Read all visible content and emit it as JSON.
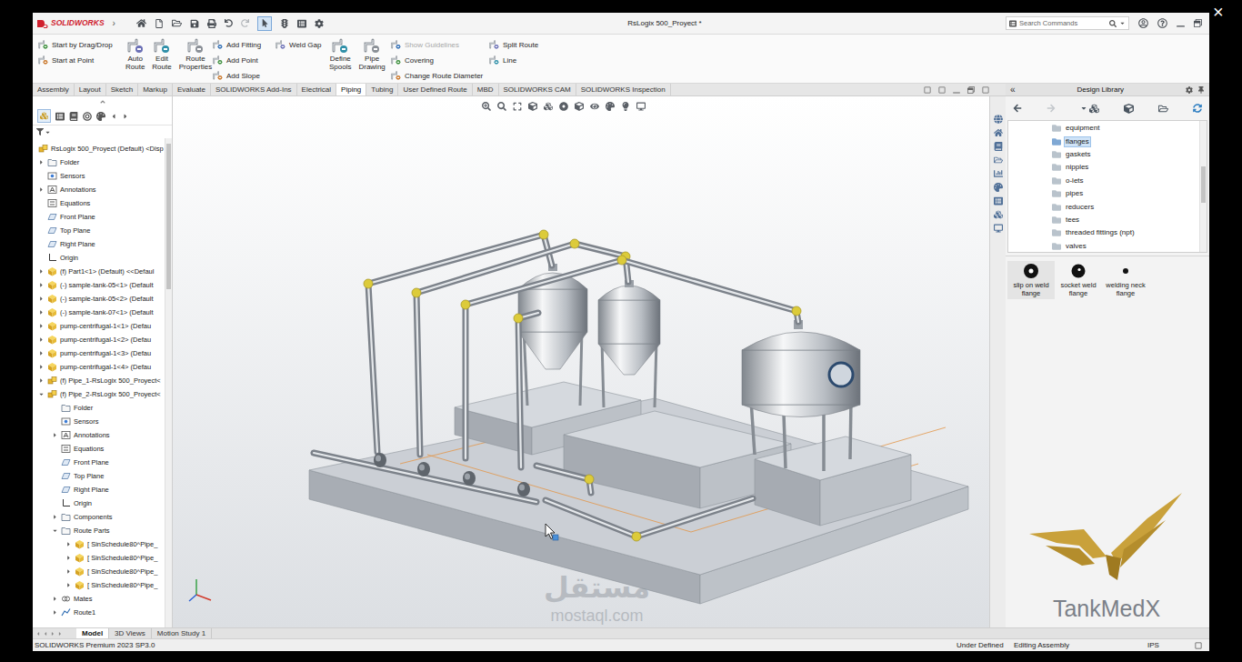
{
  "window": {
    "app": "SOLIDWORKS",
    "app_menu": "›",
    "title": "RsLogix 500_Proyect *"
  },
  "player": {
    "close": "×"
  },
  "title_toolbar": {
    "select_active": true
  },
  "search": {
    "placeholder": "Search Commands"
  },
  "ribbon": [
    {
      "kind": "stack",
      "items": [
        {
          "label": "Start by Drag/Drop",
          "disabled": false
        },
        {
          "label": "Start at Point",
          "disabled": false
        }
      ]
    },
    {
      "kind": "large",
      "items": [
        {
          "label": "Auto Route",
          "disabled": false
        },
        {
          "label": "Edit Route",
          "disabled": false
        },
        {
          "label": "Route Properties",
          "disabled": false
        }
      ]
    },
    {
      "kind": "stack",
      "items": [
        {
          "label": "Add Fitting",
          "disabled": false
        },
        {
          "label": "Add Point",
          "disabled": false
        },
        {
          "label": "Add Slope",
          "disabled": false
        }
      ]
    },
    {
      "kind": "stack",
      "items": [
        {
          "label": "Weld Gap",
          "disabled": false
        }
      ]
    },
    {
      "kind": "large",
      "items": [
        {
          "label": "Define Spools",
          "disabled": false
        },
        {
          "label": "Pipe Drawing",
          "disabled": false
        }
      ]
    },
    {
      "kind": "stack",
      "items": [
        {
          "label": "Show Guidelines",
          "disabled": true
        },
        {
          "label": "Covering",
          "disabled": false
        },
        {
          "label": "Change Route Diameter",
          "disabled": false
        }
      ]
    },
    {
      "kind": "stack",
      "items": [
        {
          "label": "Split Route",
          "disabled": false
        },
        {
          "label": "Line",
          "disabled": false
        }
      ]
    }
  ],
  "tabs": [
    {
      "label": "Assembly",
      "selected": false
    },
    {
      "label": "Layout",
      "selected": false
    },
    {
      "label": "Sketch",
      "selected": false
    },
    {
      "label": "Markup",
      "selected": false
    },
    {
      "label": "Evaluate",
      "selected": false
    },
    {
      "label": "SOLIDWORKS Add-Ins",
      "selected": false
    },
    {
      "label": "Electrical",
      "selected": false
    },
    {
      "label": "Piping",
      "selected": true
    },
    {
      "label": "Tubing",
      "selected": false
    },
    {
      "label": "User Defined Route",
      "selected": false
    },
    {
      "label": "MBD",
      "selected": false
    },
    {
      "label": "SOLIDWORKS CAM",
      "selected": false
    },
    {
      "label": "SOLIDWORKS Inspection",
      "selected": false
    }
  ],
  "feature_tree": {
    "items": [
      {
        "label": "RsLogix 500_Proyect (Default) <Disp",
        "level": 0,
        "kind": "assembly",
        "expander": "none"
      },
      {
        "label": "Folder",
        "level": 1,
        "kind": "folder",
        "expander": "collapsed"
      },
      {
        "label": "Sensors",
        "level": 1,
        "kind": "sensor",
        "expander": "none"
      },
      {
        "label": "Annotations",
        "level": 1,
        "kind": "annotation",
        "expander": "collapsed"
      },
      {
        "label": "Equations",
        "level": 1,
        "kind": "equation",
        "expander": "none"
      },
      {
        "label": "Front Plane",
        "level": 1,
        "kind": "plane",
        "expander": "none"
      },
      {
        "label": "Top Plane",
        "level": 1,
        "kind": "plane",
        "expander": "none"
      },
      {
        "label": "Right Plane",
        "level": 1,
        "kind": "plane",
        "expander": "none"
      },
      {
        "label": "Origin",
        "level": 1,
        "kind": "origin",
        "expander": "none"
      },
      {
        "label": "(f) Part1<1> (Default) <<Defaul",
        "level": 1,
        "kind": "part",
        "expander": "collapsed"
      },
      {
        "label": "(-) sample-tank-05<1> (Default",
        "level": 1,
        "kind": "part",
        "expander": "collapsed"
      },
      {
        "label": "(-) sample-tank-05<2> (Default",
        "level": 1,
        "kind": "part",
        "expander": "collapsed"
      },
      {
        "label": "(-) sample-tank-07<1> (Default",
        "level": 1,
        "kind": "part",
        "expander": "collapsed"
      },
      {
        "label": "pump-centrifugal-1<1> (Defau",
        "level": 1,
        "kind": "part",
        "expander": "collapsed"
      },
      {
        "label": "pump-centrifugal-1<2> (Defau",
        "level": 1,
        "kind": "part",
        "expander": "collapsed"
      },
      {
        "label": "pump-centrifugal-1<3> (Defau",
        "level": 1,
        "kind": "part",
        "expander": "collapsed"
      },
      {
        "label": "pump-centrifugal-1<4> (Defau",
        "level": 1,
        "kind": "part",
        "expander": "collapsed"
      },
      {
        "label": "(f) Pipe_1-RsLogix 500_Proyect<",
        "level": 1,
        "kind": "assembly",
        "expander": "collapsed"
      },
      {
        "label": "(f) Pipe_2-RsLogix 500_Proyect<",
        "level": 1,
        "kind": "assembly",
        "expander": "expanded"
      },
      {
        "label": "Folder",
        "level": 2,
        "kind": "folder",
        "expander": "none"
      },
      {
        "label": "Sensors",
        "level": 2,
        "kind": "sensor",
        "expander": "none"
      },
      {
        "label": "Annotations",
        "level": 2,
        "kind": "annotation",
        "expander": "collapsed"
      },
      {
        "label": "Equations",
        "level": 2,
        "kind": "equation",
        "expander": "none"
      },
      {
        "label": "Front Plane",
        "level": 2,
        "kind": "plane",
        "expander": "none"
      },
      {
        "label": "Top Plane",
        "level": 2,
        "kind": "plane",
        "expander": "none"
      },
      {
        "label": "Right Plane",
        "level": 2,
        "kind": "plane",
        "expander": "none"
      },
      {
        "label": "Origin",
        "level": 2,
        "kind": "origin",
        "expander": "none"
      },
      {
        "label": "Components",
        "level": 2,
        "kind": "folder",
        "expander": "collapsed"
      },
      {
        "label": "Route Parts",
        "level": 2,
        "kind": "folder",
        "expander": "expanded"
      },
      {
        "label": "[ SinSchedule80^Pipe_",
        "level": 3,
        "kind": "part",
        "expander": "collapsed"
      },
      {
        "label": "[ SinSchedule80^Pipe_",
        "level": 3,
        "kind": "part",
        "expander": "collapsed"
      },
      {
        "label": "[ SinSchedule80^Pipe_",
        "level": 3,
        "kind": "part",
        "expander": "collapsed"
      },
      {
        "label": "[ SinSchedule80^Pipe_",
        "level": 3,
        "kind": "part",
        "expander": "collapsed"
      },
      {
        "label": "Mates",
        "level": 2,
        "kind": "mates",
        "expander": "collapsed"
      },
      {
        "label": "Route1",
        "level": 2,
        "kind": "route",
        "expander": "collapsed"
      }
    ]
  },
  "viewport": {
    "watermark_arabic": "مستقل",
    "watermark_latin": "mostaql.com"
  },
  "design_library": {
    "title": "Design Library",
    "collapse": "«",
    "folders": [
      {
        "label": "equipment",
        "selected": false
      },
      {
        "label": "flanges",
        "selected": true
      },
      {
        "label": "gaskets",
        "selected": false
      },
      {
        "label": "nipples",
        "selected": false
      },
      {
        "label": "o-lets",
        "selected": false
      },
      {
        "label": "pipes",
        "selected": false
      },
      {
        "label": "reducers",
        "selected": false
      },
      {
        "label": "tees",
        "selected": false
      },
      {
        "label": "threaded fittings (npt)",
        "selected": false
      },
      {
        "label": "valves",
        "selected": false
      }
    ],
    "items": [
      {
        "label": "slip on weld flange",
        "selected": true
      },
      {
        "label": "socket weld flange",
        "selected": false
      },
      {
        "label": "welding neck flange",
        "selected": false
      }
    ]
  },
  "logo": {
    "text": "TankMedX"
  },
  "bottom_tabs": [
    {
      "label": "Model",
      "selected": true
    },
    {
      "label": "3D Views",
      "selected": false
    },
    {
      "label": "Motion Study 1",
      "selected": false
    }
  ],
  "status_bar": {
    "product": "SOLIDWORKS Premium 2023 SP3.0",
    "state": "Under Defined",
    "mode": "Editing Assembly",
    "units": "IPS"
  }
}
